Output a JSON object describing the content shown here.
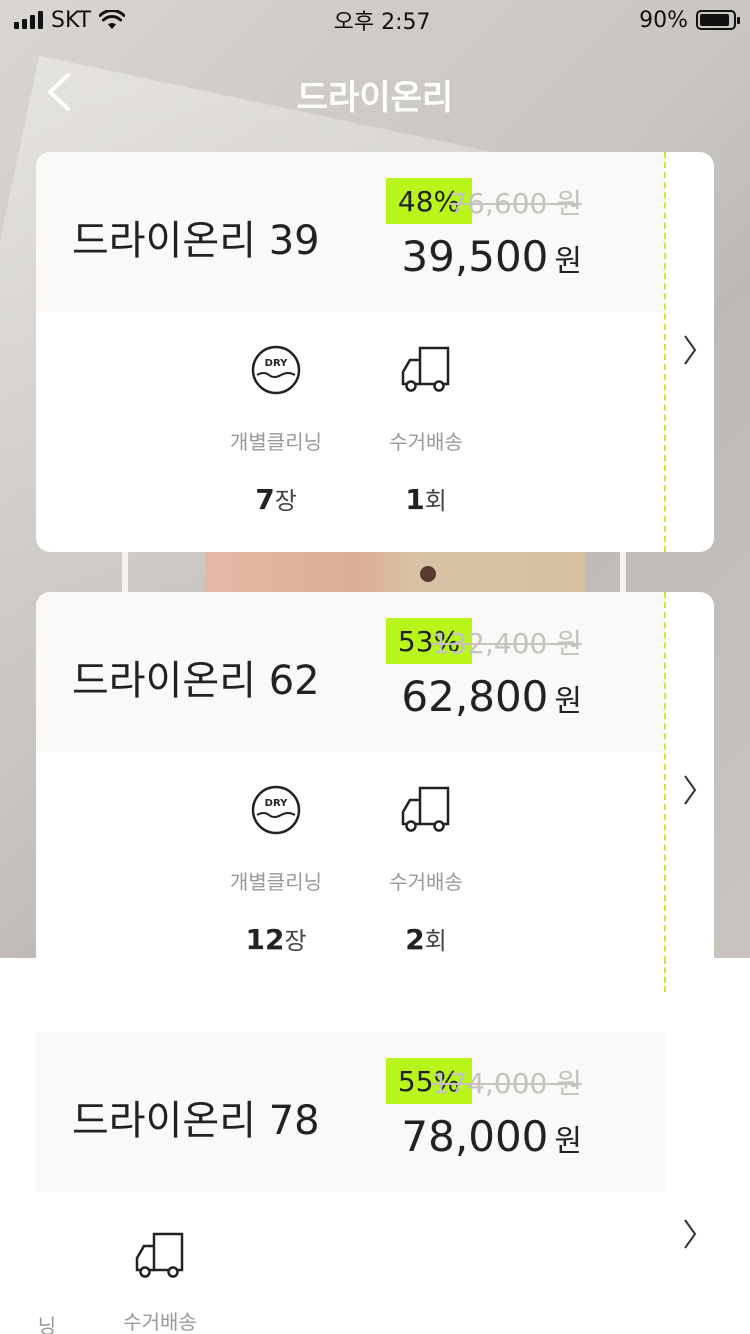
{
  "status": {
    "carrier": "SKT",
    "time": "오후 2:57",
    "battery": "90%",
    "battery_level": 0.9
  },
  "nav": {
    "title": "드라이온리"
  },
  "plans": [
    {
      "name": "드라이온리 39",
      "discount": "48%",
      "original_price": "76,600 원",
      "price": "39,500",
      "price_unit": "원",
      "features": [
        {
          "icon": "dry-cleaning-icon",
          "label": "개별클리닝",
          "count": "7",
          "unit": "장"
        },
        {
          "icon": "delivery-truck-icon",
          "label": "수거배송",
          "count": "1",
          "unit": "회"
        }
      ]
    },
    {
      "name": "드라이온리 62",
      "discount": "53%",
      "original_price": "132,400 원",
      "price": "62,800",
      "price_unit": "원",
      "features": [
        {
          "icon": "dry-cleaning-icon",
          "label": "개별클리닝",
          "count": "12",
          "unit": "장"
        },
        {
          "icon": "delivery-truck-icon",
          "label": "수거배송",
          "count": "2",
          "unit": "회"
        }
      ]
    },
    {
      "name": "드라이온리 78",
      "discount": "55%",
      "original_price": "174,000 원",
      "price": "78,000",
      "price_unit": "원",
      "features": [
        {
          "label": "닝"
        },
        {
          "icon": "delivery-truck-icon",
          "label": "수거배송"
        }
      ]
    }
  ],
  "colors": {
    "accent": "#b8f51a",
    "dashed_line": "#c8e83a",
    "card_head": "#fbf9f7"
  }
}
